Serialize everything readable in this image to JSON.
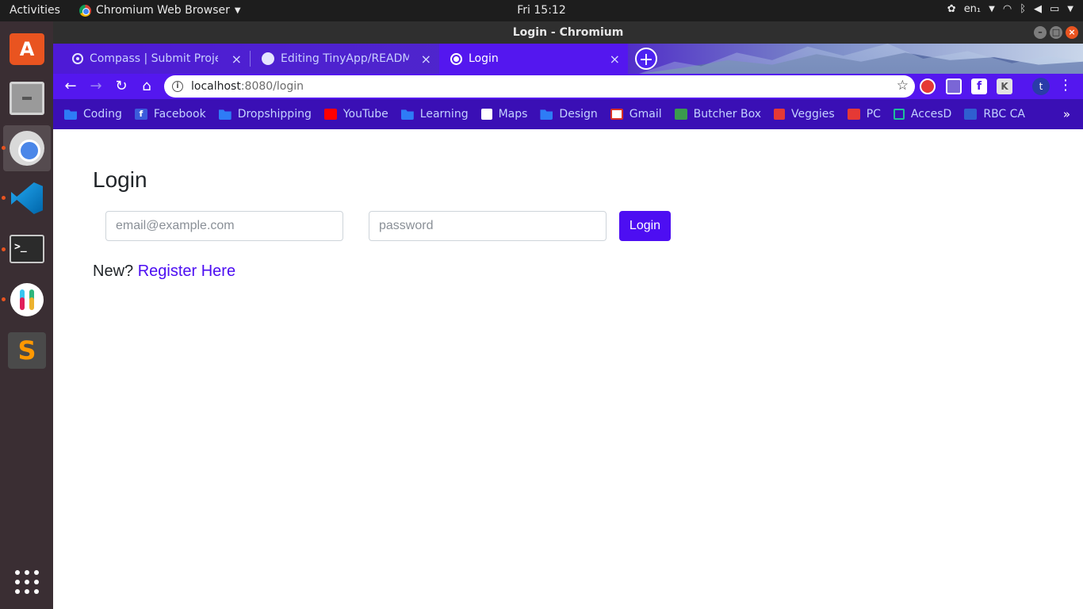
{
  "os": {
    "activities": "Activities",
    "app_menu": "Chromium Web Browser",
    "clock": "Fri 15:12",
    "lang": "en₁"
  },
  "window": {
    "title": "Login - Chromium"
  },
  "tabs": [
    {
      "title": "Compass | Submit Project",
      "icon": "compass-icon"
    },
    {
      "title": "Editing TinyApp/README.md",
      "icon": "github-icon"
    },
    {
      "title": "Login",
      "icon": "globe-icon"
    }
  ],
  "address": {
    "host": "localhost",
    "path": ":8080/login"
  },
  "bookmarks": [
    {
      "label": "Coding",
      "icon": "folder-icon"
    },
    {
      "label": "Facebook",
      "icon": "facebook-icon"
    },
    {
      "label": "Dropshipping",
      "icon": "folder-icon"
    },
    {
      "label": "YouTube",
      "icon": "youtube-icon"
    },
    {
      "label": "Learning",
      "icon": "folder-icon"
    },
    {
      "label": "Maps",
      "icon": "globe-icon"
    },
    {
      "label": "Design",
      "icon": "folder-icon"
    },
    {
      "label": "Gmail",
      "icon": "gmail-icon"
    },
    {
      "label": "Butcher Box",
      "icon": "butcher-box-icon"
    },
    {
      "label": "Veggies",
      "icon": "tomato-icon"
    },
    {
      "label": "PC",
      "icon": "pc-icon"
    },
    {
      "label": "AccesD",
      "icon": "accesd-icon"
    },
    {
      "label": "RBC CA",
      "icon": "rbc-icon"
    }
  ],
  "profile": {
    "initial": "t"
  },
  "page": {
    "title": "Login",
    "email_placeholder": "email@example.com",
    "password_placeholder": "password",
    "login_label": "Login",
    "register_prefix": "New?",
    "register_link": "Register Here"
  },
  "colors": {
    "accent": "#4d0ef2",
    "tabstrip": "#4e1ad6",
    "bookmarks_bar": "#3a0fb5",
    "dock": "#3a2e33"
  }
}
